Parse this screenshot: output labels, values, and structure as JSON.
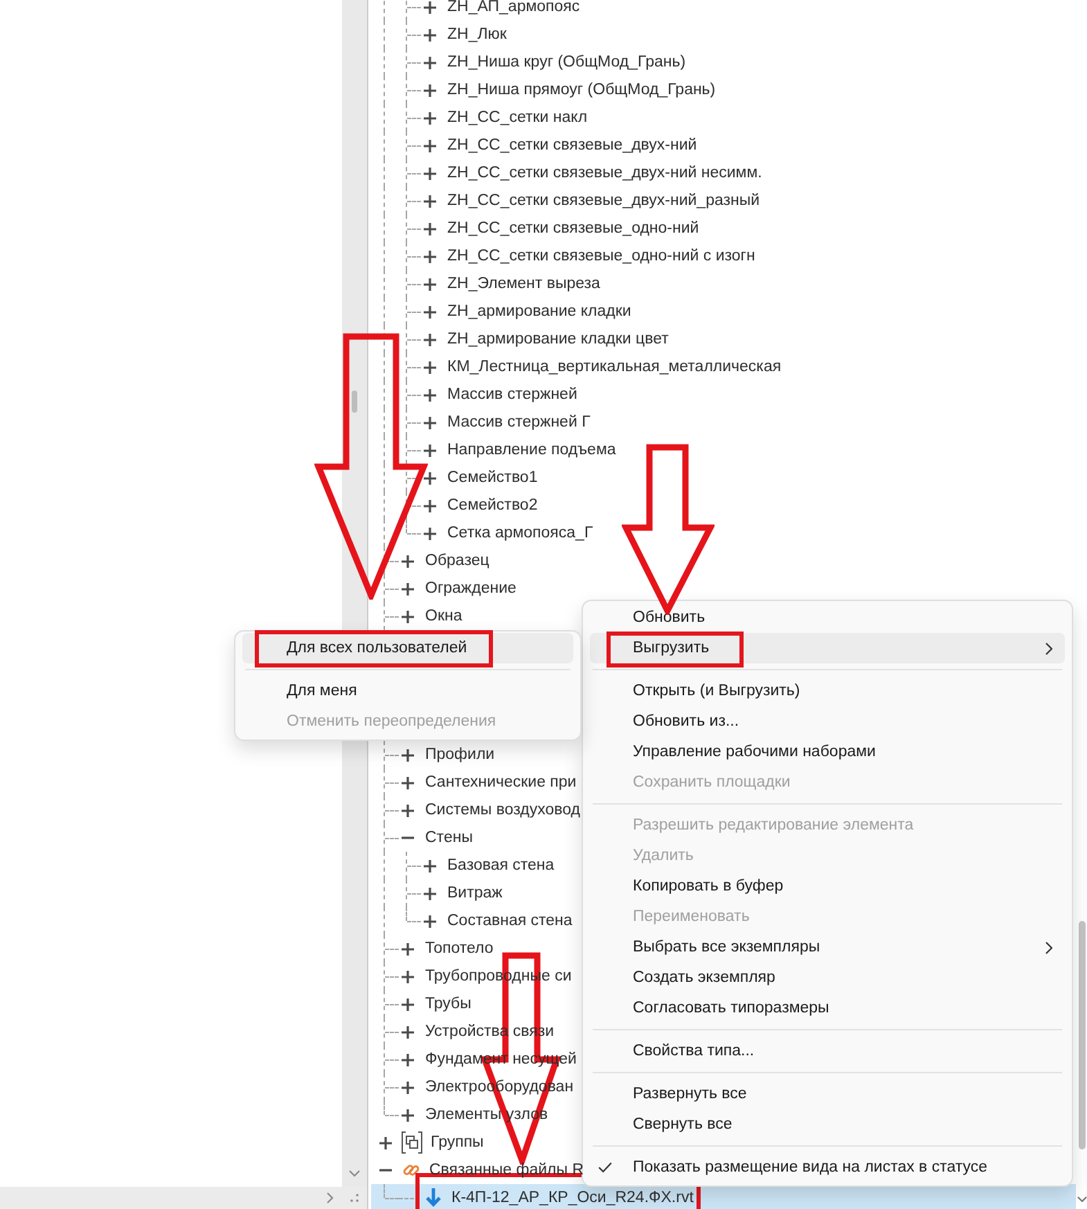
{
  "tree": {
    "items": [
      {
        "kind": "offscreen",
        "children": [
          {
            "kind": "offscreen",
            "children": [
              {
                "kind": "node",
                "label": "ZH_АП_армопояс",
                "expanded": false,
                "selected": false,
                "marked": false
              },
              {
                "kind": "node",
                "label": "ZH_Люк",
                "expanded": false,
                "selected": false,
                "marked": false
              },
              {
                "kind": "node",
                "label": "ZH_Ниша круг (ОбщМод_Грань)",
                "expanded": false,
                "selected": false,
                "marked": false
              },
              {
                "kind": "node",
                "label": "ZH_Ниша прямоуг (ОбщМод_Грань)",
                "expanded": false,
                "selected": false,
                "marked": false
              },
              {
                "kind": "node",
                "label": "ZH_СС_сетки накл",
                "expanded": false,
                "selected": false,
                "marked": false
              },
              {
                "kind": "node",
                "label": "ZH_СС_сетки связевые_двух-ний",
                "expanded": false,
                "selected": false,
                "marked": false
              },
              {
                "kind": "node",
                "label": "ZH_СС_сетки связевые_двух-ний несимм.",
                "expanded": false,
                "selected": false,
                "marked": false
              },
              {
                "kind": "node",
                "label": "ZH_СС_сетки связевые_двух-ний_разный",
                "expanded": false,
                "selected": false,
                "marked": false
              },
              {
                "kind": "node",
                "label": "ZH_СС_сетки связевые_одно-ний",
                "expanded": false,
                "selected": false,
                "marked": false
              },
              {
                "kind": "node",
                "label": "ZH_СС_сетки связевые_одно-ний с изогн",
                "expanded": false,
                "selected": false,
                "marked": false
              },
              {
                "kind": "node",
                "label": "ZH_Элемент выреза",
                "expanded": false,
                "selected": false,
                "marked": false
              },
              {
                "kind": "node",
                "label": "ZH_армирование кладки",
                "expanded": false,
                "selected": false,
                "marked": false
              },
              {
                "kind": "node",
                "label": "ZH_армирование кладки цвет",
                "expanded": false,
                "selected": false,
                "marked": false
              },
              {
                "kind": "node",
                "label": "КМ_Лестница_вертикальная_металлическая",
                "expanded": false,
                "selected": false,
                "marked": false
              },
              {
                "kind": "node",
                "label": "Массив стержней",
                "expanded": false,
                "selected": false,
                "marked": false
              },
              {
                "kind": "node",
                "label": "Массив стержней Г",
                "expanded": false,
                "selected": false,
                "marked": false
              },
              {
                "kind": "node",
                "label": "Направление подъема",
                "expanded": false,
                "selected": false,
                "marked": false
              },
              {
                "kind": "node",
                "label": "Семейство1",
                "expanded": false,
                "selected": false,
                "marked": false
              },
              {
                "kind": "node",
                "label": "Семейство2",
                "expanded": false,
                "selected": false,
                "marked": false
              },
              {
                "kind": "node",
                "label": "Сетка армопояса_Г",
                "expanded": false,
                "selected": false,
                "marked": false
              }
            ]
          },
          {
            "kind": "node",
            "label": "Образец",
            "expanded": false,
            "selected": false,
            "marked": false
          },
          {
            "kind": "node",
            "label": "Ограждение",
            "expanded": false,
            "selected": false,
            "marked": false
          },
          {
            "kind": "node",
            "label": "Окна",
            "expanded": false,
            "selected": false,
            "marked": false
          },
          {
            "kind": "covered"
          },
          {
            "kind": "covered"
          },
          {
            "kind": "covered"
          },
          {
            "kind": "covered"
          },
          {
            "kind": "node",
            "label": "Профили",
            "expanded": false,
            "selected": false,
            "marked": false
          },
          {
            "kind": "node",
            "label": "Сантехнические при",
            "expanded": false,
            "selected": false,
            "marked": false
          },
          {
            "kind": "node",
            "label": "Системы воздуховод",
            "expanded": false,
            "selected": false,
            "marked": false
          },
          {
            "kind": "node",
            "label": "Стены",
            "expanded": true,
            "selected": false,
            "marked": false,
            "children": [
              {
                "kind": "node",
                "label": "Базовая стена",
                "expanded": false,
                "selected": false,
                "marked": false
              },
              {
                "kind": "node",
                "label": "Витраж",
                "expanded": false,
                "selected": false,
                "marked": false
              },
              {
                "kind": "node",
                "label": "Составная стена",
                "expanded": false,
                "selected": false,
                "marked": false
              }
            ]
          },
          {
            "kind": "node",
            "label": "Топотело",
            "expanded": false,
            "selected": false,
            "marked": false
          },
          {
            "kind": "node",
            "label": "Трубопроводные си",
            "expanded": false,
            "selected": false,
            "marked": false
          },
          {
            "kind": "node",
            "label": "Трубы",
            "expanded": false,
            "selected": false,
            "marked": false
          },
          {
            "kind": "node",
            "label": "Устройства связи",
            "expanded": false,
            "selected": false,
            "marked": false
          },
          {
            "kind": "node",
            "label": "Фундамент несущей",
            "expanded": false,
            "selected": false,
            "marked": false
          },
          {
            "kind": "node",
            "label": "Электрооборудован",
            "expanded": false,
            "selected": false,
            "marked": false
          },
          {
            "kind": "node",
            "label": "Элементы узлов",
            "expanded": false,
            "selected": false,
            "marked": false
          }
        ]
      },
      {
        "kind": "group",
        "label": "Группы",
        "expanded": false,
        "selected": false,
        "marked": false
      },
      {
        "kind": "links",
        "label": "Связанные файлы R",
        "expanded": true,
        "selected": false,
        "marked": false,
        "children": [
          {
            "kind": "file",
            "label": "К-4П-12_АР_КР_Оси_R24.ФХ.rvt",
            "selected": true,
            "marked": true
          }
        ]
      }
    ]
  },
  "context_menu": {
    "items": [
      {
        "kind": "item",
        "label": "Обновить",
        "highlighted": false,
        "disabled": false,
        "submenu": false,
        "checked": false,
        "marked": false
      },
      {
        "kind": "item",
        "label": "Выгрузить",
        "highlighted": true,
        "disabled": false,
        "submenu": true,
        "checked": false,
        "marked": true
      },
      {
        "kind": "separator"
      },
      {
        "kind": "item",
        "label": "Открыть (и Выгрузить)",
        "highlighted": false,
        "disabled": false,
        "submenu": false,
        "checked": false,
        "marked": false
      },
      {
        "kind": "item",
        "label": "Обновить из...",
        "highlighted": false,
        "disabled": false,
        "submenu": false,
        "checked": false,
        "marked": false
      },
      {
        "kind": "item",
        "label": "Управление рабочими наборами",
        "highlighted": false,
        "disabled": false,
        "submenu": false,
        "checked": false,
        "marked": false
      },
      {
        "kind": "item",
        "label": "Сохранить площадки",
        "highlighted": false,
        "disabled": true,
        "submenu": false,
        "checked": false,
        "marked": false
      },
      {
        "kind": "separator"
      },
      {
        "kind": "item",
        "label": "Разрешить редактирование элемента",
        "highlighted": false,
        "disabled": true,
        "submenu": false,
        "checked": false,
        "marked": false
      },
      {
        "kind": "item",
        "label": "Удалить",
        "highlighted": false,
        "disabled": true,
        "submenu": false,
        "checked": false,
        "marked": false
      },
      {
        "kind": "item",
        "label": "Копировать в буфер",
        "highlighted": false,
        "disabled": false,
        "submenu": false,
        "checked": false,
        "marked": false
      },
      {
        "kind": "item",
        "label": "Переименовать",
        "highlighted": false,
        "disabled": true,
        "submenu": false,
        "checked": false,
        "marked": false
      },
      {
        "kind": "item",
        "label": "Выбрать все экземпляры",
        "highlighted": false,
        "disabled": false,
        "submenu": true,
        "checked": false,
        "marked": false
      },
      {
        "kind": "item",
        "label": "Создать экземпляр",
        "highlighted": false,
        "disabled": false,
        "submenu": false,
        "checked": false,
        "marked": false
      },
      {
        "kind": "item",
        "label": "Согласовать типоразмеры",
        "highlighted": false,
        "disabled": false,
        "submenu": false,
        "checked": false,
        "marked": false
      },
      {
        "kind": "separator"
      },
      {
        "kind": "item",
        "label": "Свойства типа...",
        "highlighted": false,
        "disabled": false,
        "submenu": false,
        "checked": false,
        "marked": false
      },
      {
        "kind": "separator"
      },
      {
        "kind": "item",
        "label": "Развернуть все",
        "highlighted": false,
        "disabled": false,
        "submenu": false,
        "checked": false,
        "marked": false
      },
      {
        "kind": "item",
        "label": "Свернуть все",
        "highlighted": false,
        "disabled": false,
        "submenu": false,
        "checked": false,
        "marked": false
      },
      {
        "kind": "separator"
      },
      {
        "kind": "item",
        "label": "Показать размещение вида на листах в статусе",
        "highlighted": false,
        "disabled": false,
        "submenu": false,
        "checked": true,
        "marked": false
      }
    ]
  },
  "submenu": {
    "items": [
      {
        "kind": "item",
        "label": "Для всех пользователей",
        "highlighted": true,
        "disabled": false,
        "marked": true
      },
      {
        "kind": "separator"
      },
      {
        "kind": "item",
        "label": "Для меня",
        "highlighted": false,
        "disabled": false,
        "marked": false
      },
      {
        "kind": "item",
        "label": "Отменить переопределения",
        "highlighted": false,
        "disabled": true,
        "marked": false
      }
    ]
  },
  "annotations": [
    {
      "kind": "arrow"
    },
    {
      "kind": "arrow"
    },
    {
      "kind": "arrow"
    }
  ]
}
